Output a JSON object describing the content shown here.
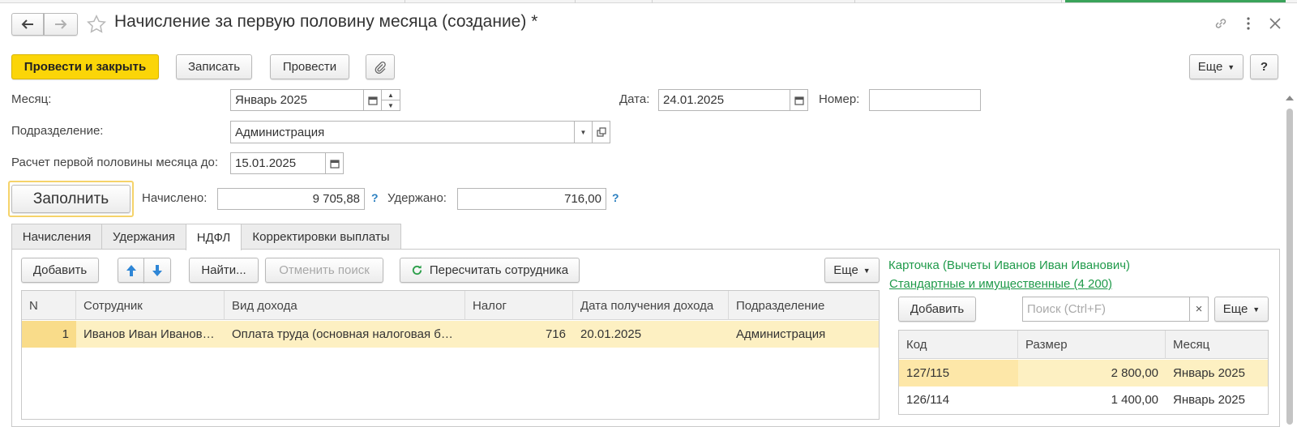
{
  "window": {
    "title": "Начисление за первую половину месяца (создание) *"
  },
  "toolbar": {
    "post_close": "Провести и закрыть",
    "write": "Записать",
    "post": "Провести",
    "more": "Еще",
    "help": "?"
  },
  "form": {
    "month_label": "Месяц:",
    "month_value": "Январь 2025",
    "date_label": "Дата:",
    "date_value": "24.01.2025",
    "number_label": "Номер:",
    "number_value": "",
    "division_label": "Подразделение:",
    "division_value": "Администрация",
    "calc_until_label": "Расчет первой половины месяца до:",
    "calc_until_value": "15.01.2025",
    "fill_button": "Заполнить",
    "accrued_label": "Начислено:",
    "accrued_value": "9 705,88",
    "withheld_label": "Удержано:",
    "withheld_value": "716,00",
    "help_mark": "?"
  },
  "tabs": [
    {
      "label": "Начисления"
    },
    {
      "label": "Удержания"
    },
    {
      "label": "НДФЛ"
    },
    {
      "label": "Корректировки выплаты"
    }
  ],
  "ndfl": {
    "add_button": "Добавить",
    "find_button": "Найти...",
    "cancel_search_button": "Отменить поиск",
    "recalc_button": "Пересчитать сотрудника",
    "more": "Еще",
    "columns": [
      "N",
      "Сотрудник",
      "Вид дохода",
      "Налог",
      "Дата получения дохода",
      "Подразделение"
    ],
    "rows": [
      {
        "n": "1",
        "employee": "Иванов Иван Иванов…",
        "income_type": "Оплата труда (основная налоговая б…",
        "tax": "716",
        "date": "20.01.2025",
        "division": "Администрация"
      }
    ]
  },
  "deductions": {
    "card_title": "Карточка (Вычеты Иванов Иван Иванович)",
    "standard_link": "Стандартные и имущественные (4 200)",
    "add_button": "Добавить",
    "search_placeholder": "Поиск (Ctrl+F)",
    "clear": "×",
    "more": "Еще",
    "columns": [
      "Код",
      "Размер",
      "Месяц"
    ],
    "rows": [
      {
        "code": "127/115",
        "amount": "2 800,00",
        "month": "Январь 2025"
      },
      {
        "code": "126/114",
        "amount": "1 400,00",
        "month": "Январь 2025"
      }
    ]
  },
  "colors": {
    "accent_yellow": "#fbd508",
    "link_green": "#1f9a4a",
    "selected_row": "#fdf0c2",
    "help_blue": "#2a7fc0"
  }
}
